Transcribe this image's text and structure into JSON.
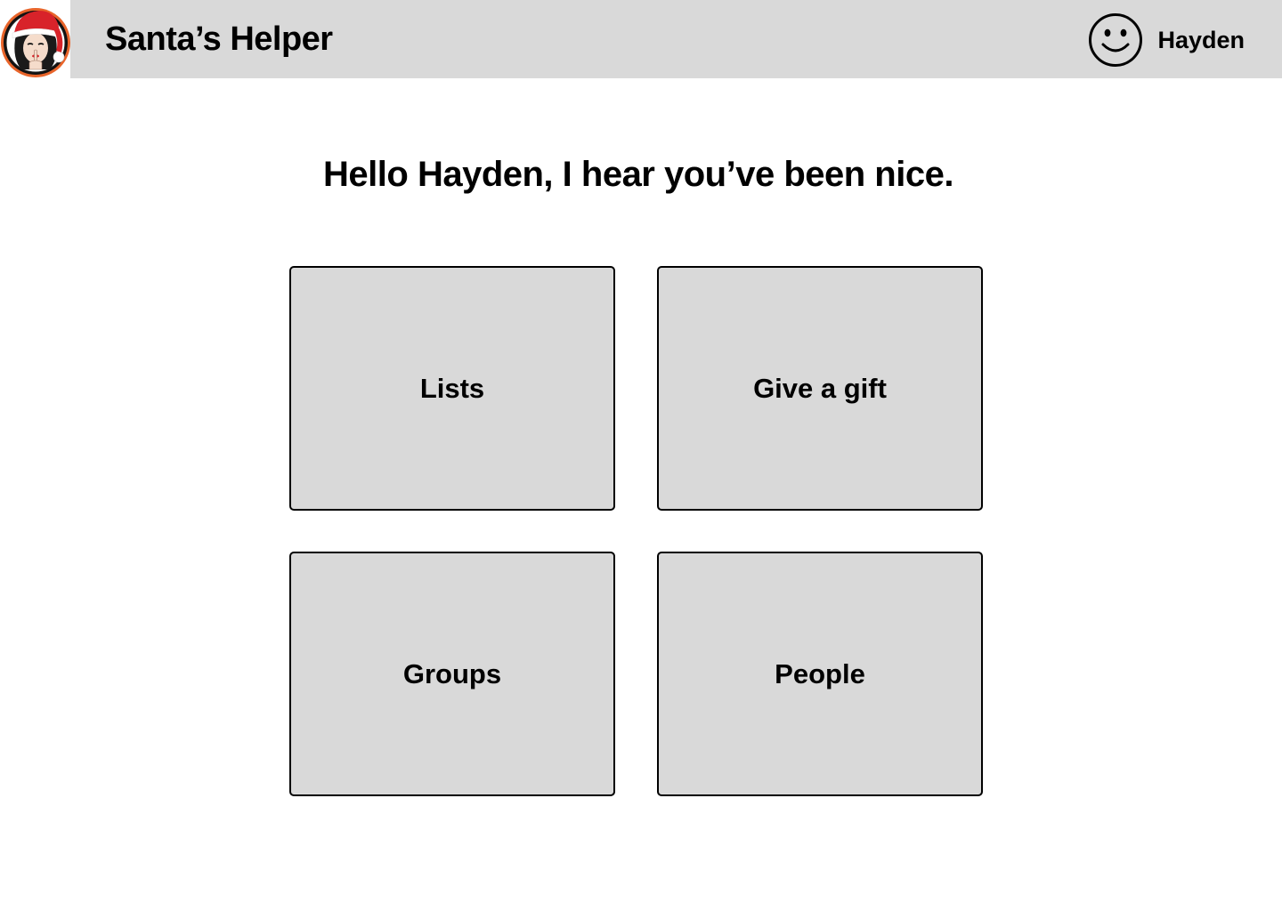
{
  "header": {
    "app_title": "Santa’s Helper",
    "logo_icon": "santa-hat-woman-logo",
    "user": {
      "avatar_icon": "smiley-face-icon",
      "name": "Hayden"
    }
  },
  "main": {
    "greeting": "Hello Hayden, I hear you’ve been nice.",
    "tiles": [
      {
        "label": "Lists"
      },
      {
        "label": "Give a gift"
      },
      {
        "label": "Groups"
      },
      {
        "label": "People"
      }
    ]
  },
  "colors": {
    "header_bg": "#d9d9d9",
    "tile_bg": "#d9d9d9",
    "logo_ring": "#e8642a",
    "hat_red": "#d8232a"
  }
}
